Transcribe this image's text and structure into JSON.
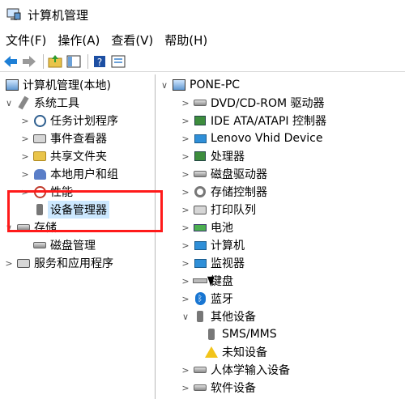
{
  "window": {
    "title": "计算机管理"
  },
  "menu": [
    "文件(F)",
    "操作(A)",
    "查看(V)",
    "帮助(H)"
  ],
  "toolbar": [
    {
      "name": "back-icon"
    },
    {
      "name": "forward-icon"
    },
    {
      "name": "up-folder-icon"
    },
    {
      "name": "show-hide-tree-icon"
    },
    {
      "name": "help-icon"
    },
    {
      "name": "properties-icon"
    }
  ],
  "left_tree": {
    "root": "计算机管理(本地)",
    "items": [
      {
        "label": "系统工具",
        "level": 1,
        "arrow": "∨",
        "icon": "tools-icon"
      },
      {
        "label": "任务计划程序",
        "level": 2,
        "arrow": ">",
        "icon": "clock-icon"
      },
      {
        "label": "事件查看器",
        "level": 2,
        "arrow": ">",
        "icon": "event-viewer-icon"
      },
      {
        "label": "共享文件夹",
        "level": 2,
        "arrow": ">",
        "icon": "shared-folder-icon"
      },
      {
        "label": "本地用户和组",
        "level": 2,
        "arrow": ">",
        "icon": "users-icon"
      },
      {
        "label": "性能",
        "level": 2,
        "arrow": ">",
        "icon": "performance-icon"
      },
      {
        "label": "设备管理器",
        "level": 2,
        "arrow": "",
        "icon": "device-manager-icon",
        "selected": true
      },
      {
        "label": "存储",
        "level": 1,
        "arrow": "∨",
        "icon": "storage-icon"
      },
      {
        "label": "磁盘管理",
        "level": 2,
        "arrow": "",
        "icon": "disk-icon"
      },
      {
        "label": "服务和应用程序",
        "level": 1,
        "arrow": ">",
        "icon": "services-icon"
      }
    ]
  },
  "right_tree": {
    "root": "PONE-PC",
    "items": [
      {
        "label": "DVD/CD-ROM 驱动器",
        "arrow": ">",
        "icon": "dvd-drive-icon"
      },
      {
        "label": "IDE ATA/ATAPI 控制器",
        "arrow": ">",
        "icon": "ide-controller-icon"
      },
      {
        "label": "Lenovo Vhid Device",
        "arrow": ">",
        "icon": "monitor-icon"
      },
      {
        "label": "处理器",
        "arrow": ">",
        "icon": "processor-icon"
      },
      {
        "label": "磁盘驱动器",
        "arrow": ">",
        "icon": "disk-drive-icon"
      },
      {
        "label": "存储控制器",
        "arrow": ">",
        "icon": "storage-controller-icon"
      },
      {
        "label": "打印队列",
        "arrow": ">",
        "icon": "printer-icon"
      },
      {
        "label": "电池",
        "arrow": ">",
        "icon": "battery-icon"
      },
      {
        "label": "计算机",
        "arrow": ">",
        "icon": "computer-icon"
      },
      {
        "label": "监视器",
        "arrow": ">",
        "icon": "monitor-icon"
      },
      {
        "label": "键盘",
        "arrow": ">",
        "icon": "keyboard-icon"
      },
      {
        "label": "蓝牙",
        "arrow": ">",
        "icon": "bluetooth-icon"
      },
      {
        "label": "其他设备",
        "arrow": "∨",
        "icon": "other-devices-icon"
      },
      {
        "label": "SMS/MMS",
        "arrow": "",
        "icon": "unknown-device-icon",
        "child": true
      },
      {
        "label": "未知设备",
        "arrow": "",
        "icon": "warning-device-icon",
        "child": true
      },
      {
        "label": "人体学输入设备",
        "arrow": ">",
        "icon": "hid-icon"
      },
      {
        "label": "软件设备",
        "arrow": ">",
        "icon": "software-device-icon"
      }
    ]
  },
  "colors": {
    "highlight": "#ff1a1a",
    "selection": "#cce8ff"
  }
}
